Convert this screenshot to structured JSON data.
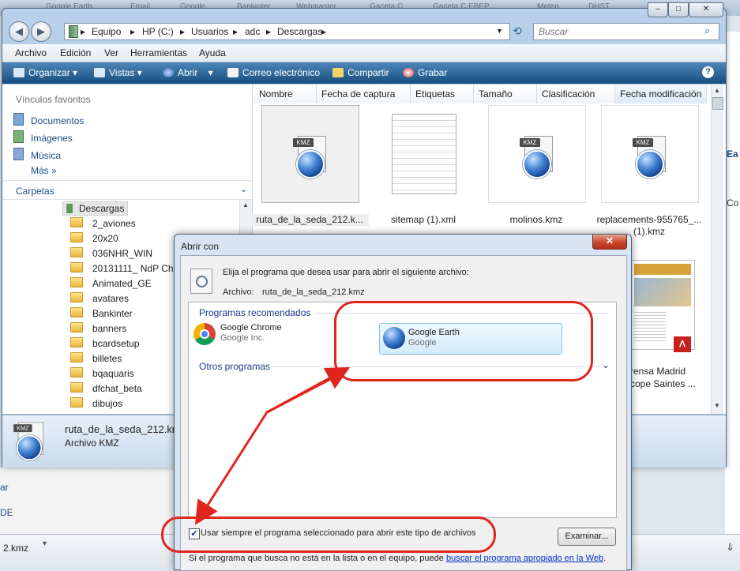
{
  "background": {
    "tabs": [
      "Google Earth",
      "Email",
      "Google",
      "Bankinter",
      "Webmaster",
      "Gaceta C",
      "Gaceta C EBEP",
      "Meteo",
      "DHST"
    ],
    "right_fragments": [
      "Ea",
      "Co"
    ],
    "bottom_fragments": [
      "ar",
      "DE"
    ],
    "taskbar_file": "2.kmz"
  },
  "explorer": {
    "breadcrumb": [
      "Equipo",
      "HP (C:)",
      "Usuarios",
      "adc",
      "Descargas"
    ],
    "search_placeholder": "Buscar",
    "menu": [
      "Archivo",
      "Edición",
      "Ver",
      "Herramientas",
      "Ayuda"
    ],
    "toolbar": {
      "organize": "Organizar",
      "views": "Vistas",
      "open": "Abrir",
      "email": "Correo electrónico",
      "share": "Compartir",
      "burn": "Grabar"
    },
    "favorites": {
      "header": "Vínculos favoritos",
      "items": [
        "Documentos",
        "Imágenes",
        "Música"
      ],
      "more": "Más"
    },
    "folders": {
      "header": "Carpetas",
      "current": "Descargas",
      "items": [
        "2_aviones",
        "20x20",
        "036NHR_WIN",
        "20131111_ NdP Christ",
        "Animated_GE",
        "avatares",
        "Bankinter",
        "banners",
        "bcardsetup",
        "billetes",
        "bqaquaris",
        "dfchat_beta",
        "dibujos"
      ]
    },
    "columns": [
      "Nombre",
      "Fecha de captura",
      "Etiquetas",
      "Tamaño",
      "Clasificación",
      "Fecha modificación"
    ],
    "files": [
      {
        "name": "ruta_de_la_seda_212.k...",
        "type": "kmz"
      },
      {
        "name": "sitemap (1).xml",
        "type": "doc"
      },
      {
        "name": "molinos.kmz",
        "type": "kmz"
      },
      {
        "name": "replacements-955765_... (1).kmz",
        "type": "kmz"
      }
    ],
    "pdf_caption_line1": "rensa Madrid",
    "pdf_caption_line2": "cope Saintes ...",
    "status": {
      "filename": "ruta_de_la_seda_212.kmz",
      "filetype": "Archivo KMZ"
    },
    "kmz_label": "KMZ"
  },
  "dialog": {
    "title": "Abrir con",
    "instruction": "Elija el programa que desea usar para abrir el siguiente archivo:",
    "file_label": "Archivo:",
    "file_name": "ruta_de_la_seda_212.kmz",
    "recommended_header": "Programas recomendados",
    "programs": [
      {
        "name": "Google Chrome",
        "publisher": "Google Inc."
      },
      {
        "name": "Google Earth",
        "publisher": "Google"
      }
    ],
    "other_header": "Otros programas",
    "always_use_label": "Usar siempre el programa seleccionado para abrir este tipo de archivos",
    "always_use_checked": true,
    "browse_button": "Examinar...",
    "footer_text": "Si el programa que busca no está en la lista o en el equipo, puede ",
    "footer_link": "buscar el programa apropiado en la Web",
    "footer_end": "."
  },
  "colors": {
    "annotation_red": "#e0251f",
    "toolbar_blue": "#1f5689",
    "link_blue": "#0033cc"
  }
}
